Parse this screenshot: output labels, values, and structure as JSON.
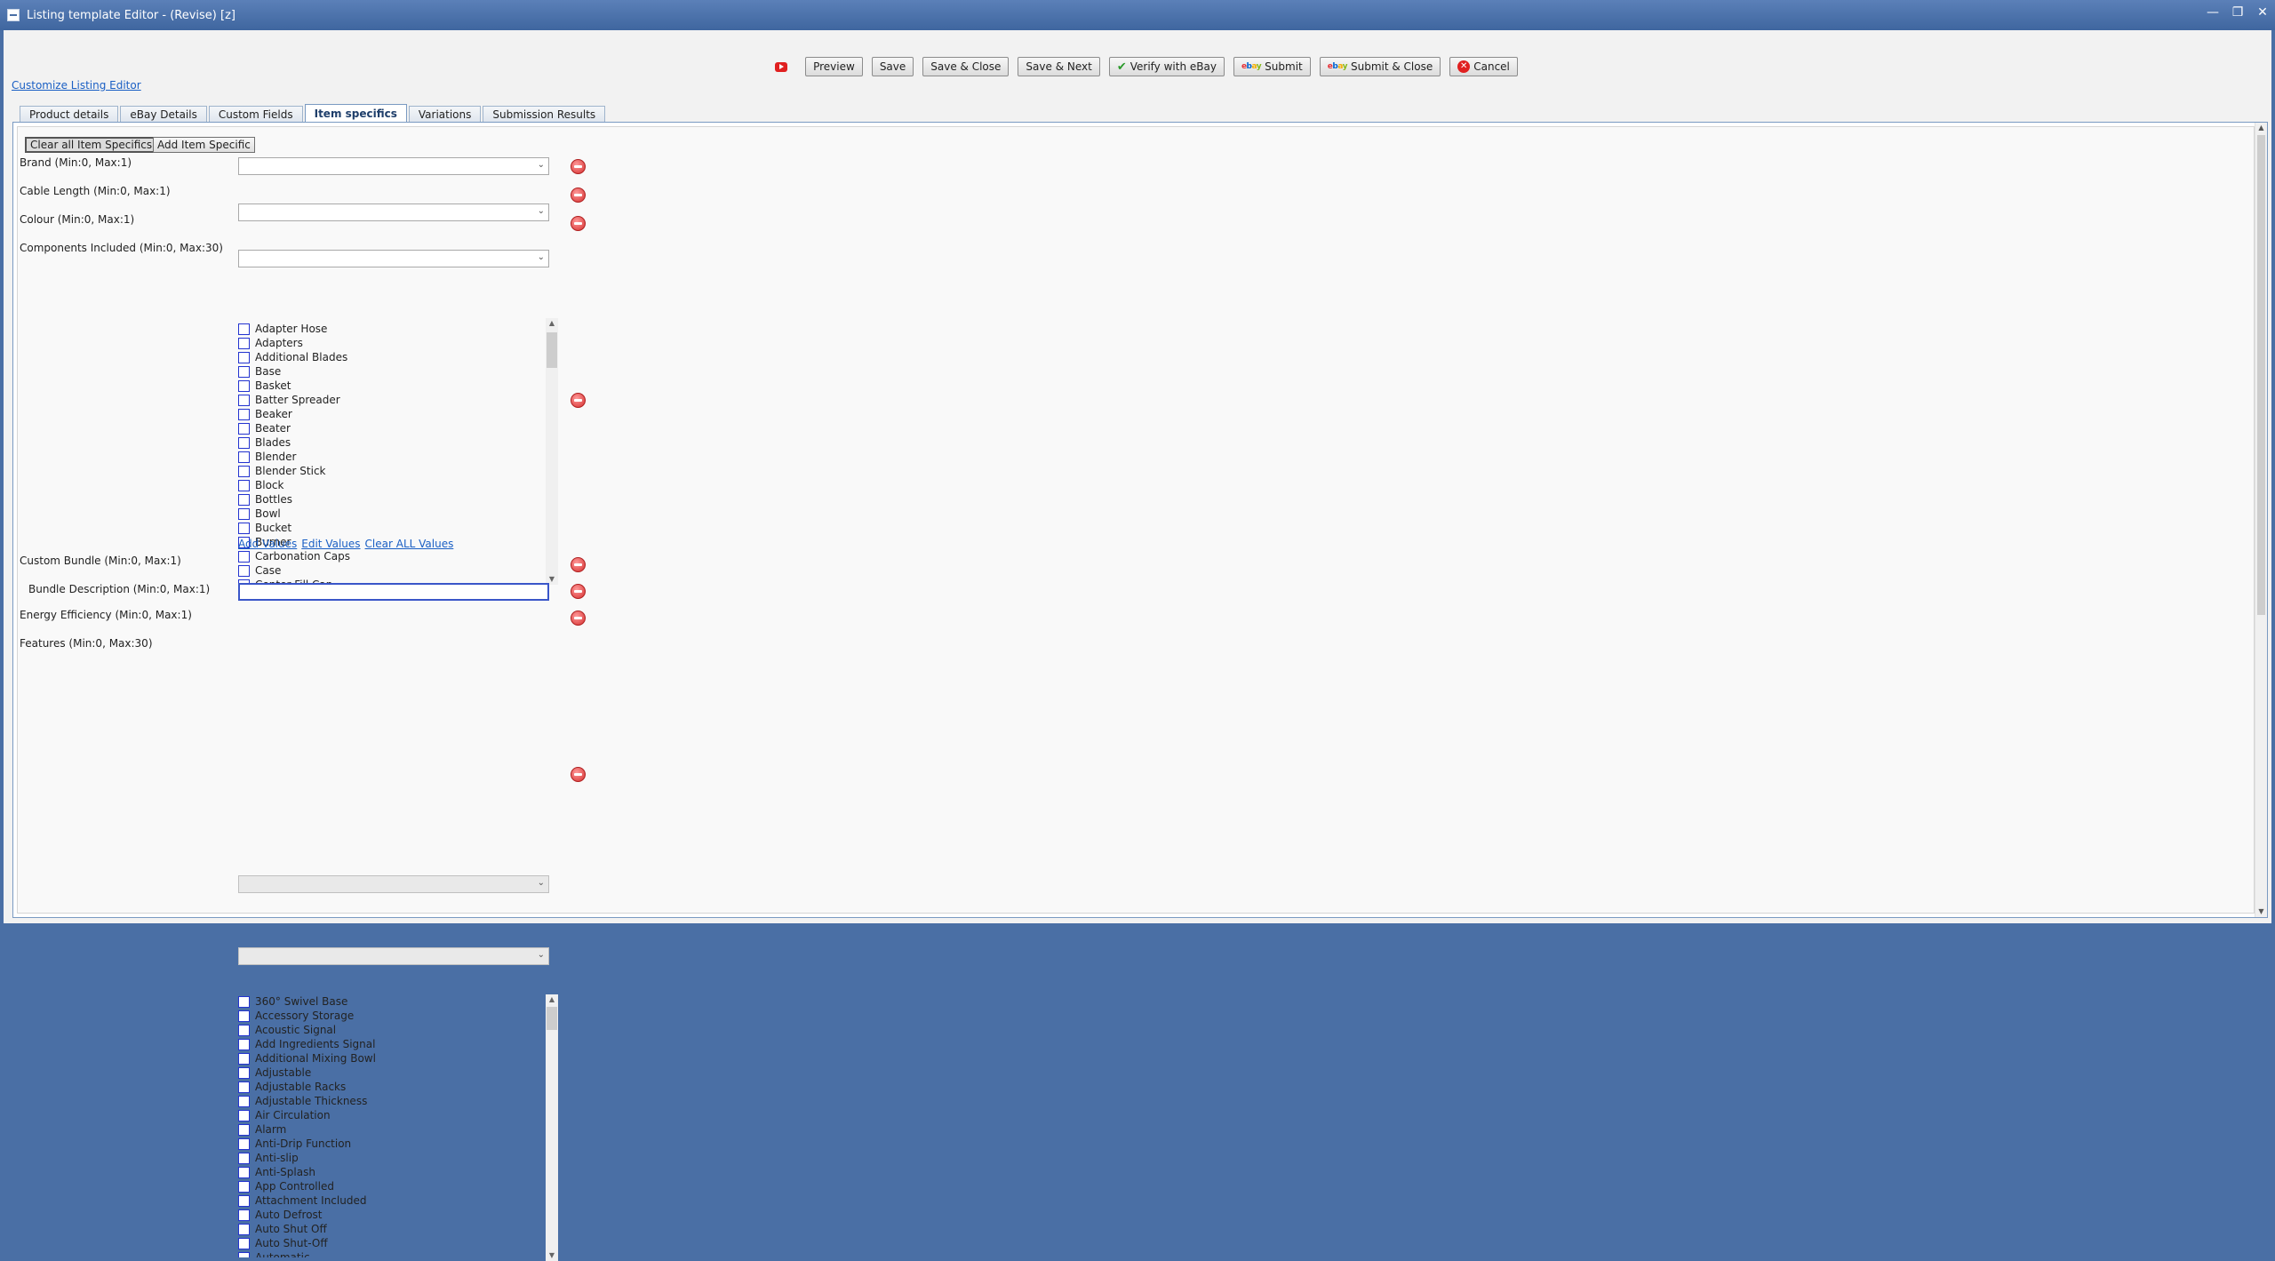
{
  "window": {
    "title": "Listing template Editor - (Revise) [z]",
    "controls": {
      "minimize": "—",
      "restore": "❐",
      "close": "✕"
    }
  },
  "toolbar": {
    "preview": "Preview",
    "save": "Save",
    "save_close": "Save & Close",
    "save_next": "Save & Next",
    "verify": "Verify with eBay",
    "submit": "Submit",
    "submit_close": "Submit & Close",
    "cancel": "Cancel"
  },
  "customize_link": "Customize Listing Editor",
  "tabs": [
    {
      "label": "Product details",
      "active": false
    },
    {
      "label": "eBay Details",
      "active": false
    },
    {
      "label": "Custom Fields",
      "active": false
    },
    {
      "label": "Item specifics",
      "active": true
    },
    {
      "label": "Variations",
      "active": false
    },
    {
      "label": "Submission Results",
      "active": false
    }
  ],
  "actions": {
    "clear_all": "Clear all Item Specifics",
    "add_specific": "Add Item Specific"
  },
  "fields": {
    "brand": "Brand (Min:0, Max:1)",
    "cable_length": "Cable Length (Min:0, Max:1)",
    "colour": "Colour (Min:0, Max:1)",
    "components": "Components Included (Min:0, Max:30)",
    "custom_bundle": "Custom Bundle (Min:0, Max:1)",
    "bundle_description": "Bundle Description (Min:0, Max:1)",
    "energy_efficiency": "Energy Efficiency (Min:0, Max:1)",
    "features": "Features (Min:0, Max:30)"
  },
  "components_values": [
    "Adapter Hose",
    "Adapters",
    "Additional Blades",
    "Base",
    "Basket",
    "Batter Spreader",
    "Beaker",
    "Beater",
    "Blades",
    "Blender",
    "Blender Stick",
    "Block",
    "Bottles",
    "Bowl",
    "Bucket",
    "Burner",
    "Carbonation Caps",
    "Case",
    "Center Fill Cap"
  ],
  "features_values": [
    "360° Swivel Base",
    "Accessory Storage",
    "Acoustic Signal",
    "Add Ingredients Signal",
    "Additional Mixing Bowl",
    "Adjustable",
    "Adjustable Racks",
    "Adjustable Thickness",
    "Air Circulation",
    "Alarm",
    "Anti-Drip Function",
    "Anti-slip",
    "Anti-Splash",
    "App Controlled",
    "Attachment Included",
    "Auto Defrost",
    "Auto Shut Off",
    "Auto Shut-Off",
    "Automatic"
  ],
  "value_links": {
    "add": "Add Values",
    "edit": "Edit Values",
    "clear": "Clear ALL Values"
  }
}
